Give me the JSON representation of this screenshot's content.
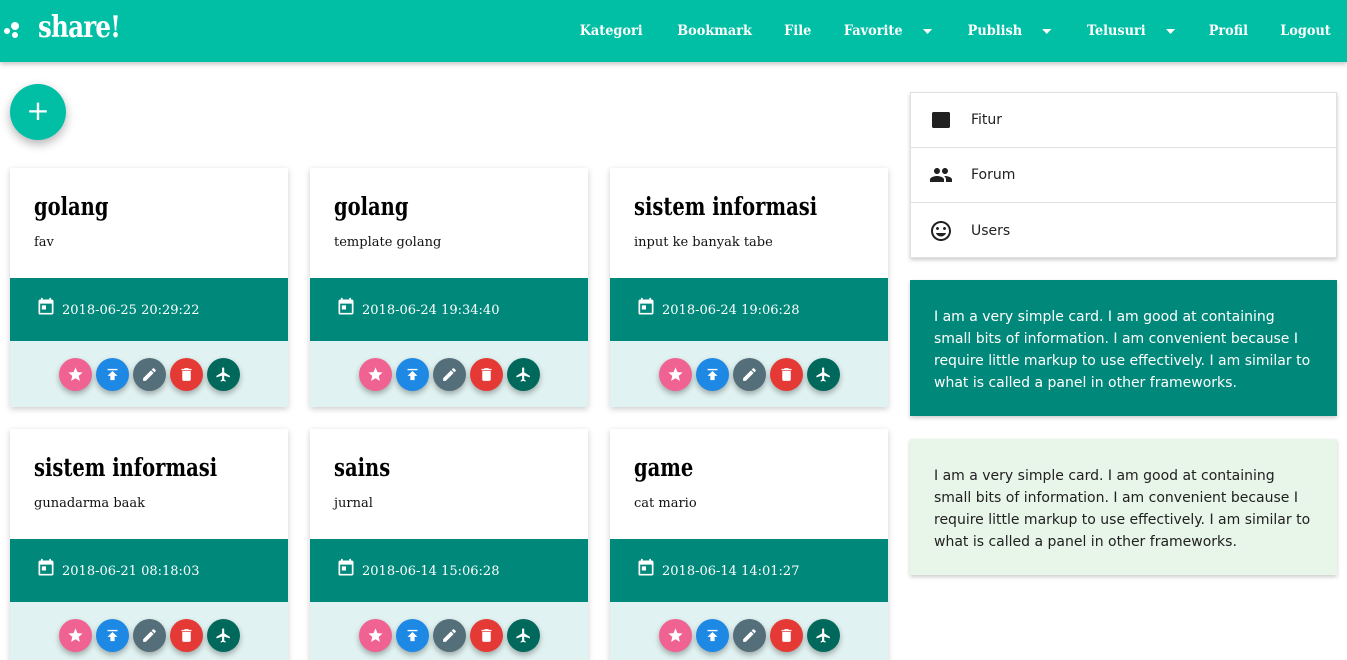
{
  "brand": {
    "name": "share!"
  },
  "nav": {
    "items": [
      {
        "label": "Kategori",
        "dropdown": false
      },
      {
        "label": "Bookmark",
        "dropdown": false
      },
      {
        "label": "File",
        "dropdown": false
      },
      {
        "label": "Favorite",
        "dropdown": true
      },
      {
        "label": "Publish",
        "dropdown": true
      },
      {
        "label": "Telusuri",
        "dropdown": true
      },
      {
        "label": "Profil",
        "dropdown": false
      },
      {
        "label": "Logout",
        "dropdown": false
      }
    ]
  },
  "fab": {
    "icon": "+"
  },
  "posts": [
    {
      "title": "golang",
      "desc": "fav",
      "date": "2018-06-25 20:29:22"
    },
    {
      "title": "golang",
      "desc": "template golang",
      "date": "2018-06-24 19:34:40"
    },
    {
      "title": "sistem informasi",
      "desc": "input ke banyak tabe",
      "date": "2018-06-24 19:06:28"
    },
    {
      "title": "sistem informasi",
      "desc": "gunadarma baak",
      "date": "2018-06-21 08:18:03"
    },
    {
      "title": "sains",
      "desc": "jurnal",
      "date": "2018-06-14 15:06:28"
    },
    {
      "title": "game",
      "desc": "cat mario",
      "date": "2018-06-14 14:01:27"
    }
  ],
  "sidebar": {
    "items": [
      {
        "label": "Fitur",
        "icon": "web-asset-icon"
      },
      {
        "label": "Forum",
        "icon": "people-icon"
      },
      {
        "label": "Users",
        "icon": "smiley-icon"
      }
    ]
  },
  "cards": [
    {
      "text": "I am a very simple card. I am good at containing small bits of information. I am convenient because I require little markup to use effectively. I am similar to what is called a panel in other frameworks."
    },
    {
      "text": "I am a very simple card. I am good at containing small bits of information. I am convenient because I require little markup to use effectively. I am similar to what is called a panel in other frameworks."
    }
  ],
  "colors": {
    "primary": "#00bfa5",
    "date_bar": "#00897b",
    "actions_bg": "#e0f2f1",
    "fav": "#f06292",
    "publish": "#1e88e5",
    "edit": "#546e7a",
    "delete": "#e53935",
    "fly": "#00695c",
    "light_card": "#e8f5e9"
  }
}
